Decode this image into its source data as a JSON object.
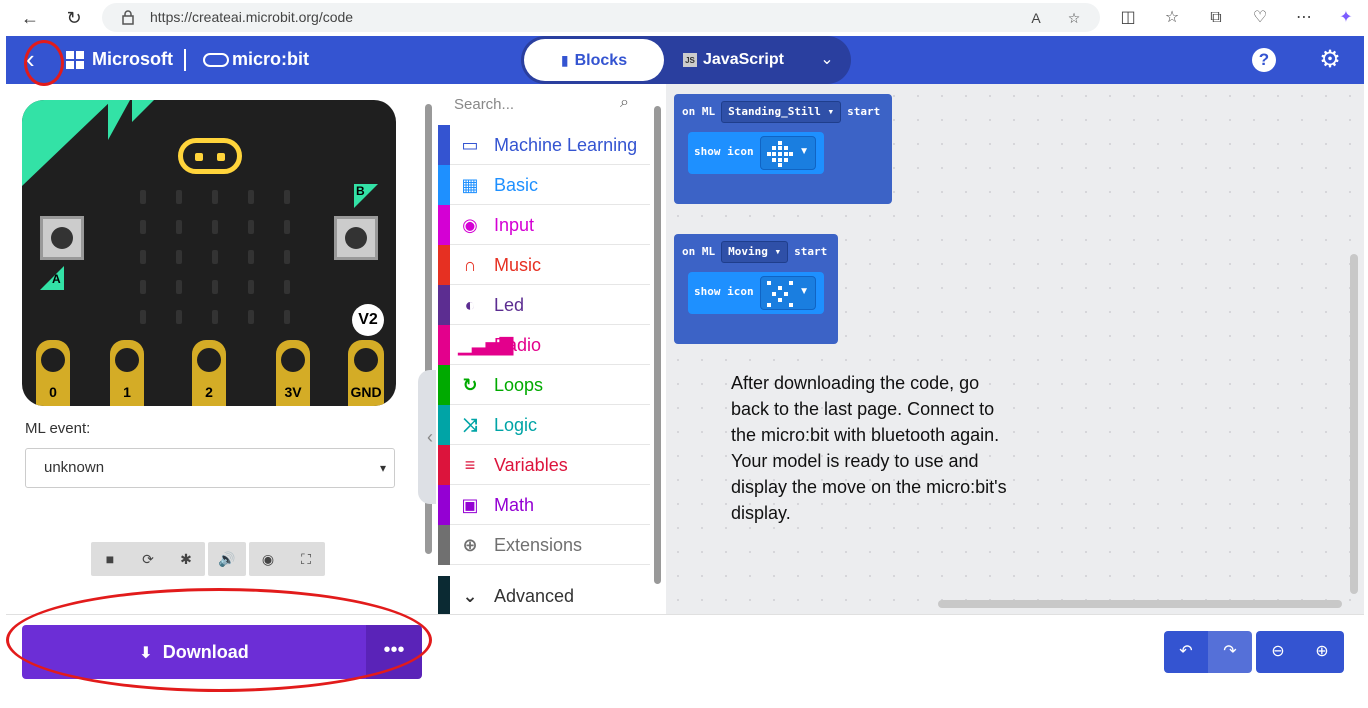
{
  "browser": {
    "url": "https://createai.microbit.org/code"
  },
  "header": {
    "brand": "Microsoft",
    "product": "micro:bit",
    "tabs": [
      {
        "label": "Blocks",
        "active": true
      },
      {
        "label": "JavaScript",
        "active": false
      }
    ]
  },
  "simulator": {
    "pins": [
      "0",
      "1",
      "2",
      "3V",
      "GND"
    ],
    "button_a": "A",
    "button_b": "B",
    "version_badge": "V2",
    "ml_event_label": "ML event:",
    "ml_event_value": "unknown"
  },
  "toolbox": {
    "search_placeholder": "Search...",
    "categories": [
      {
        "label": "Machine Learning",
        "color": "#3454d1",
        "icon": "monitor-icon"
      },
      {
        "label": "Basic",
        "color": "#1e90ff",
        "icon": "grid-icon"
      },
      {
        "label": "Input",
        "color": "#d400d4",
        "icon": "target-icon"
      },
      {
        "label": "Music",
        "color": "#e63022",
        "icon": "headphones-icon"
      },
      {
        "label": "Led",
        "color": "#5c2d91",
        "icon": "toggle-icon"
      },
      {
        "label": "Radio",
        "color": "#e3008c",
        "icon": "signal-icon"
      },
      {
        "label": "Loops",
        "color": "#00aa00",
        "icon": "refresh-icon"
      },
      {
        "label": "Logic",
        "color": "#00a4a6",
        "icon": "shuffle-icon"
      },
      {
        "label": "Variables",
        "color": "#dc143c",
        "icon": "list-icon"
      },
      {
        "label": "Math",
        "color": "#9400d3",
        "icon": "calculator-icon"
      },
      {
        "label": "Extensions",
        "color": "#707070",
        "icon": "plus-circle-icon"
      }
    ],
    "advanced_label": "Advanced",
    "advanced_color": "#0b2a33"
  },
  "workspace": {
    "blocks": [
      {
        "on": "on ML",
        "event": "Standing_Still",
        "start": "start",
        "inner": "show icon"
      },
      {
        "on": "on ML",
        "event": "Moving",
        "start": "start",
        "inner": "show icon"
      }
    ],
    "note": "After downloading the code, go back to the last page. Connect to the micro:bit with bluetooth again. Your model is ready to use and display the move on the micro:bit's display."
  },
  "bottom": {
    "download_label": "Download",
    "more_label": "•••"
  },
  "colors": {
    "header": "#3454d1",
    "download": "#6c2ed6",
    "annotation": "#e21b1b"
  }
}
